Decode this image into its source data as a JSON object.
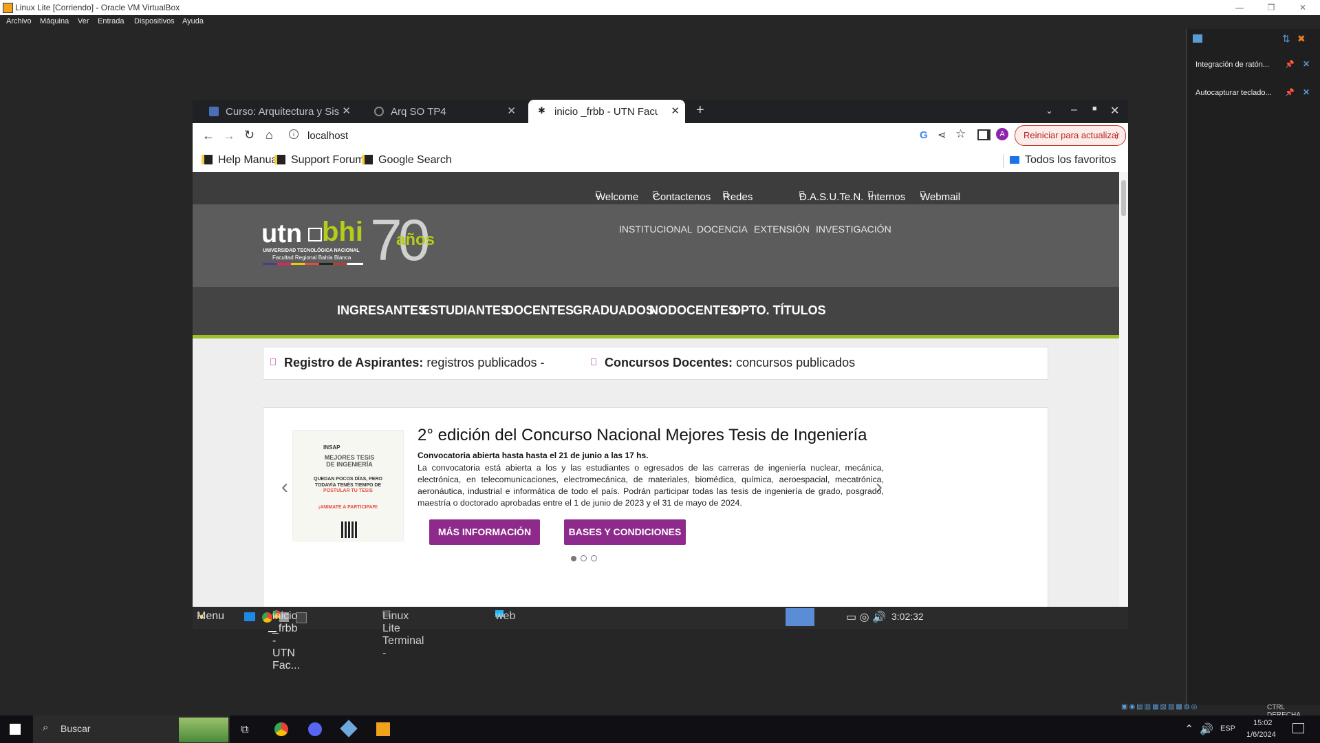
{
  "host": {
    "title": "Linux Lite [Corriendo] - Oracle VM VirtualBox",
    "menu": [
      "Archivo",
      "Máquina",
      "Ver",
      "Entrada",
      "Dispositivos",
      "Ayuda"
    ],
    "side_items": [
      "Integración de ratón...",
      "Autocapturar teclado..."
    ],
    "status_label": "CTRL DERECHA"
  },
  "chrome": {
    "tabs": [
      {
        "title": "Curso: Arquitectura y Sis"
      },
      {
        "title": "Arq SO TP4"
      },
      {
        "title": "inicio _frbb - UTN Facult"
      }
    ],
    "url": "localhost",
    "update_button": "Reiniciar para actualizar",
    "profile_initial": "A",
    "bookmarks": [
      "Help Manual",
      "Support Forums",
      "Google Search"
    ],
    "all_bookmarks": "Todos los favoritos"
  },
  "site": {
    "topbar": [
      "Welcome",
      "Contactenos",
      "Redes Sociales",
      "D.A.S.U.Te.N.",
      "Internos",
      "Webmail"
    ],
    "logo": {
      "brand": "utn",
      "sub": "bhi",
      "line1": "UNIVERSIDAD TECNOLÓGICA NACIONAL",
      "line2": "Facultad Regional Bahía Blanca",
      "anniv_number": "70",
      "anniv_word": "años"
    },
    "header_nav": [
      "INSTITUCIONAL",
      "DOCENCIA",
      "EXTENSIÓN",
      "INVESTIGACIÓN"
    ],
    "main_nav": [
      "INGRESANTES",
      "ESTUDIANTES",
      "DOCENTES",
      "GRADUADOS",
      "NODOCENTES",
      "DPTO. TÍTULOS"
    ],
    "ticker": [
      {
        "bold": "Registro de Aspirantes:",
        "text": "registros publicados -"
      },
      {
        "bold": "Concursos Docentes:",
        "text": "concursos publicados"
      }
    ],
    "slide": {
      "title": "2° edición del Concurso Nacional Mejores Tesis de Ingeniería",
      "subtitle": "Convocatoria abierta hasta hasta el 21 de junio a las 17 hs.",
      "body": "La convocatoria está abierta a los y las estudiantes o egresados de las carreras de ingeniería nuclear, mecánica, electrónica, en telecomunicaciones, electromecánica, de materiales, biomédica, química, aeroespacial, mecatrónica, aeronáutica, industrial e informática de todo el país. Podrán participar todas las tesis de ingeniería de grado, posgrado, maestría o doctorado aprobadas entre el 1 de junio de 2023 y el 31 de mayo de 2024.",
      "btn1": "MÁS INFORMACIÓN",
      "btn2": "BASES Y CONDICIONES",
      "poster": {
        "org": "INSAP",
        "title": "MEJORES TESIS DE INGENIERÍA",
        "headline": "QUEDAN POCOS DÍAS, PERO TODAVÍA TENÉS TIEMPO DE",
        "highlight": "POSTULAR TU TESIS",
        "cta": "¡ANIMATE A PARTICIPAR!"
      }
    }
  },
  "guest_taskbar": {
    "menu": "Menu",
    "items": [
      "inicio _frbb - UTN Fac...",
      "Linux Lite Terminal -",
      "web"
    ],
    "clock": "3:02:32"
  },
  "win_taskbar": {
    "search": "Buscar",
    "lang": "ESP",
    "time": "15:02",
    "date": "1/6/2024"
  }
}
